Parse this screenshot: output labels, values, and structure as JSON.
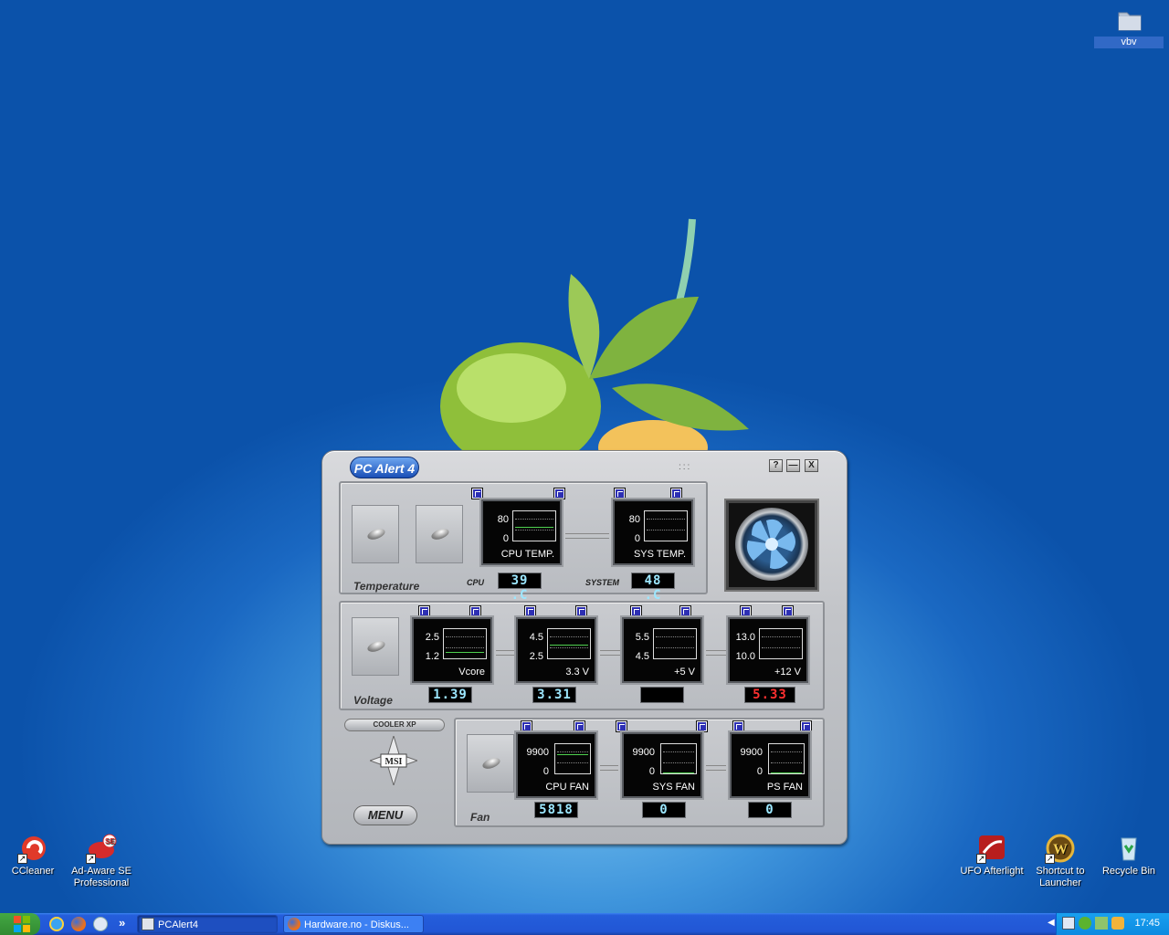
{
  "desktop": {
    "icons": [
      {
        "label": "vbv",
        "icon": "folder-icon"
      },
      {
        "label": "CCleaner",
        "icon": "ccleaner-icon"
      },
      {
        "label": "Ad-Aware SE Professional",
        "icon": "ad-aware-icon"
      },
      {
        "label": "UFO Afterlight",
        "icon": "ufo-afterlight-icon"
      },
      {
        "label": "Shortcut to Launcher",
        "icon": "wow-launcher-icon"
      },
      {
        "label": "Recycle Bin",
        "icon": "recycle-bin-icon"
      }
    ]
  },
  "pcalert": {
    "title": "PCAlert4",
    "logo_text": "PC Alert 4",
    "buttons": {
      "help": "?",
      "minimize": "—",
      "close": "X"
    },
    "temperature": {
      "section_label": "Temperature",
      "cpu_label": "CPU",
      "system_label": "SYSTEM",
      "monitors": [
        {
          "name": "CPU TEMP.",
          "high": "80",
          "low": "0",
          "value": "39 .C"
        },
        {
          "name": "SYS TEMP.",
          "high": "80",
          "low": "0",
          "value": "48 .C"
        }
      ]
    },
    "voltage": {
      "section_label": "Voltage",
      "monitors": [
        {
          "name": "Vcore",
          "high": "2.5",
          "low": "1.2",
          "value": "1.39",
          "status": "normal"
        },
        {
          "name": "3.3 V",
          "high": "4.5",
          "low": "2.5",
          "value": "3.31",
          "status": "normal"
        },
        {
          "name": "+5 V",
          "high": "5.5",
          "low": "4.5",
          "value": "",
          "status": "normal"
        },
        {
          "name": "+12 V",
          "high": "13.0",
          "low": "10.0",
          "value": "5.33",
          "status": "alarm"
        }
      ]
    },
    "fan": {
      "section_label": "Fan",
      "monitors": [
        {
          "name": "CPU FAN",
          "high": "9900",
          "low": "0",
          "value": "5818"
        },
        {
          "name": "SYS FAN",
          "high": "9900",
          "low": "0",
          "value": "0"
        },
        {
          "name": "PS FAN",
          "high": "9900",
          "low": "0",
          "value": "0"
        }
      ]
    },
    "cooler_xp_label": "COOLER XP",
    "msi_label": "MSI",
    "menu_label": "MENU"
  },
  "taskbar": {
    "tasks": [
      {
        "label": "PCAlert4",
        "active": true
      },
      {
        "label": "Hardware.no - Diskus...",
        "active": false
      }
    ],
    "quicklaunch_more": "»",
    "clock": "17:45"
  },
  "colors": {
    "accent": "#245edb",
    "alarm": "#ff3030",
    "lcd": "#9ce7ff"
  }
}
